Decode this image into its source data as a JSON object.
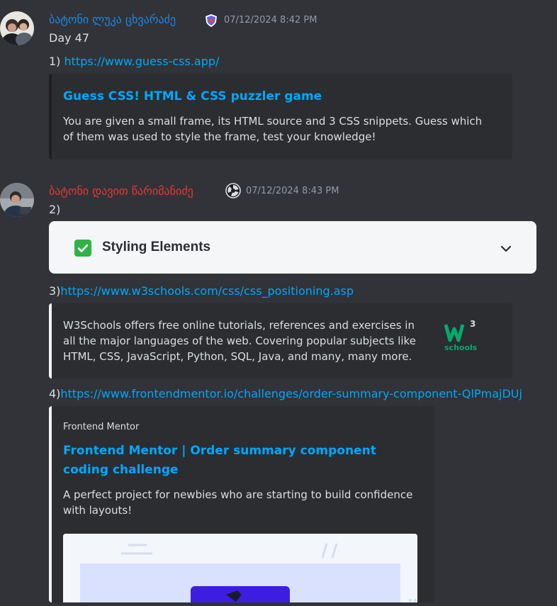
{
  "messages": [
    {
      "author": "ბატონი ლუკა ცხვარაძე",
      "author_color": "#1e88e5",
      "timestamp": "07/12/2024 8:42 PM",
      "badge_icon": "shield-heart-badge-icon",
      "lines": [
        "Day 47"
      ],
      "link1_prefix": "1)",
      "link1_url": "https://www.guess-css.app/",
      "embed1": {
        "title": "Guess CSS! HTML & CSS puzzler game",
        "desc": "You are given a small frame, its HTML source and 3 CSS snippets. Guess which of them was used to style the frame, test your knowledge!"
      }
    },
    {
      "author": "ბატონი დავით წარიმანიძე",
      "author_color": "#e53935",
      "timestamp": "07/12/2024 8:43 PM",
      "badge_icon": "spinner-badge-icon",
      "item2": "2)",
      "card": {
        "title": "Styling Elements"
      },
      "link3_prefix": "3)",
      "link3_url": "https://www.w3schools.com/css/css_positioning.asp",
      "embed3": {
        "desc": "W3Schools offers free online tutorials, references and exercises in all the major languages of the web. Covering popular subjects like HTML, CSS, JavaScript, Python, SQL, Java, and many, many more.",
        "logo_text": "schools",
        "logo_sup": "3"
      },
      "link4_prefix": "4)",
      "link4_url": "https://www.frontendmentor.io/challenges/order-summary-component-QlPmajDUj",
      "embed4": {
        "provider": "Frontend Mentor",
        "title": "Frontend Mentor | Order summary component coding challenge",
        "desc": "A perfect project for newbies who are starting to build confidence with layouts!"
      }
    }
  ],
  "colors": {
    "background": "#313338",
    "link": "#00a8fc",
    "embed_bg": "#2b2d31",
    "w3_green": "#04aa6d",
    "checkbox_green": "#2fb344"
  }
}
